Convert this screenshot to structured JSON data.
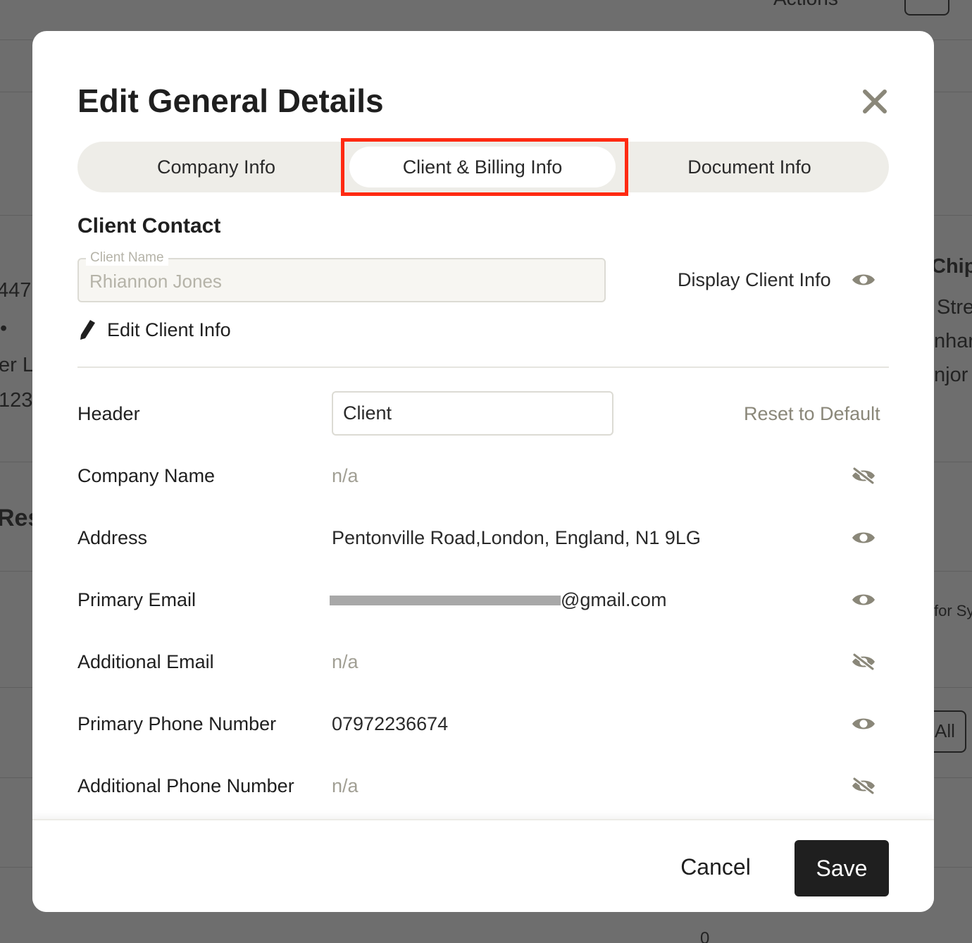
{
  "modal": {
    "title": "Edit General Details",
    "tabs": [
      {
        "label": "Company Info",
        "active": false
      },
      {
        "label": "Client & Billing Info",
        "active": true
      },
      {
        "label": "Document Info",
        "active": false
      }
    ],
    "client_contact": {
      "section_title": "Client Contact",
      "client_name_legend": "Client Name",
      "client_name_value": "Rhiannon Jones",
      "display_label": "Display Client Info",
      "edit_link": "Edit Client Info"
    },
    "rows": {
      "header": {
        "label": "Header",
        "value": "Client",
        "reset": "Reset to Default"
      },
      "company_name": {
        "label": "Company Name",
        "value": "n/a",
        "visible": false
      },
      "address": {
        "label": "Address",
        "value": "Pentonville Road,London, England, N1 9LG",
        "visible": true
      },
      "primary_email": {
        "label": "Primary Email",
        "value": "@gmail.com",
        "visible": true
      },
      "additional_email": {
        "label": "Additional Email",
        "value": "n/a",
        "visible": false
      },
      "primary_phone": {
        "label": "Primary Phone Number",
        "value": "07972236674",
        "visible": true
      },
      "additional_phone": {
        "label": "Additional Phone Number",
        "value": "n/a",
        "visible": false
      }
    },
    "footer": {
      "cancel": "Cancel",
      "save": "Save"
    }
  },
  "background": {
    "top_right": "Actions",
    "left": [
      "447",
      "•",
      "er L",
      "123",
      "Res"
    ],
    "right": [
      "Chip",
      "Stre",
      "nhar",
      "njor",
      "for Sy",
      "All",
      "0"
    ]
  },
  "colors": {
    "highlight": "#ff2a12",
    "primary_button": "#1f1f1f",
    "muted": "#a19f94"
  }
}
